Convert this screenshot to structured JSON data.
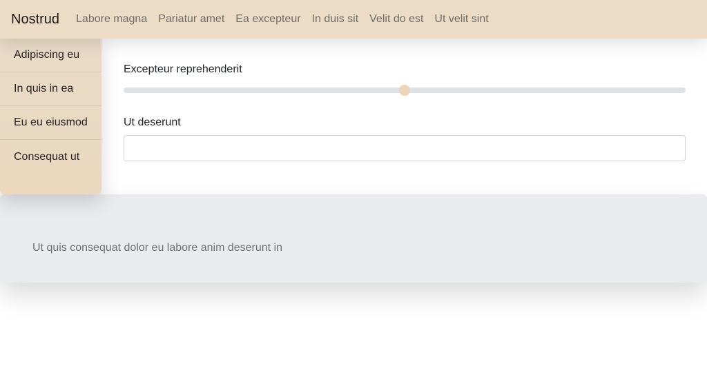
{
  "navbar": {
    "brand": "Nostrud",
    "links": [
      "Labore magna",
      "Pariatur amet",
      "Ea excepteur",
      "In duis sit",
      "Velit do est",
      "Ut velit sint"
    ]
  },
  "sidebar": {
    "items": [
      "Adipiscing eu",
      "In quis in ea",
      "Eu eu eiusmod",
      "Consequat ut"
    ]
  },
  "form": {
    "slider_label": "Excepteur reprehenderit",
    "slider_value": 50,
    "slider_min": 0,
    "slider_max": 100,
    "text_label": "Ut deserunt",
    "text_value": ""
  },
  "panel": {
    "text": "Ut quis consequat dolor eu labore anim deserunt in"
  },
  "colors": {
    "navbar_bg": "#ecdcc6",
    "accent": "#ecd6b8",
    "panel_bg": "#eaebef"
  }
}
